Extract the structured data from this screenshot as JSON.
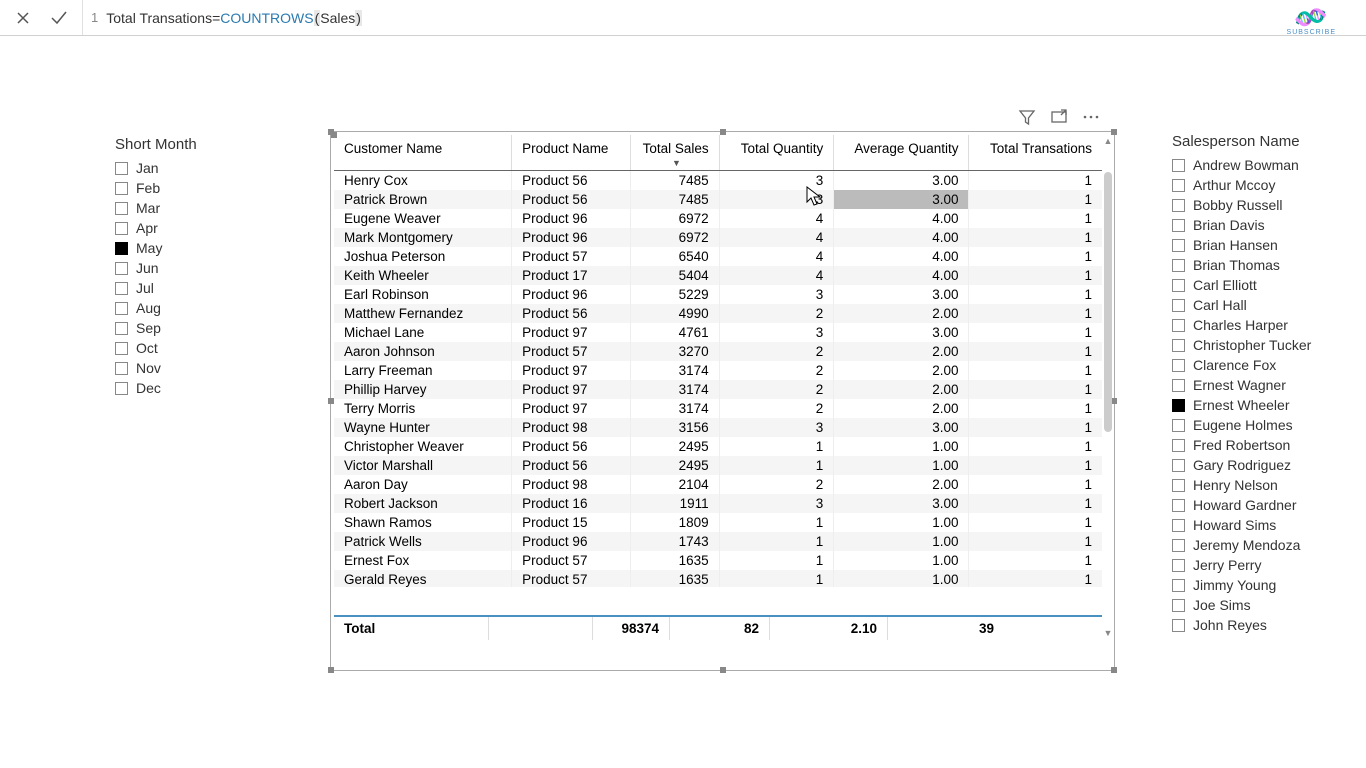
{
  "formula": {
    "line": "1",
    "measure": "Total Transations",
    "eq": " = ",
    "func": "COUNTROWS",
    "open": "(",
    "arg": " Sales ",
    "close": ")"
  },
  "monthSlicer": {
    "title": "Short Month",
    "items": [
      {
        "label": "Jan",
        "checked": false
      },
      {
        "label": "Feb",
        "checked": false
      },
      {
        "label": "Mar",
        "checked": false
      },
      {
        "label": "Apr",
        "checked": false
      },
      {
        "label": "May",
        "checked": true
      },
      {
        "label": "Jun",
        "checked": false
      },
      {
        "label": "Jul",
        "checked": false
      },
      {
        "label": "Aug",
        "checked": false
      },
      {
        "label": "Sep",
        "checked": false
      },
      {
        "label": "Oct",
        "checked": false
      },
      {
        "label": "Nov",
        "checked": false
      },
      {
        "label": "Dec",
        "checked": false
      }
    ]
  },
  "salesSlicer": {
    "title": "Salesperson Name",
    "items": [
      {
        "label": "Andrew Bowman",
        "checked": false
      },
      {
        "label": "Arthur Mccoy",
        "checked": false
      },
      {
        "label": "Bobby Russell",
        "checked": false
      },
      {
        "label": "Brian Davis",
        "checked": false
      },
      {
        "label": "Brian Hansen",
        "checked": false
      },
      {
        "label": "Brian Thomas",
        "checked": false
      },
      {
        "label": "Carl Elliott",
        "checked": false
      },
      {
        "label": "Carl Hall",
        "checked": false
      },
      {
        "label": "Charles Harper",
        "checked": false
      },
      {
        "label": "Christopher Tucker",
        "checked": false
      },
      {
        "label": "Clarence Fox",
        "checked": false
      },
      {
        "label": "Ernest Wagner",
        "checked": false
      },
      {
        "label": "Ernest Wheeler",
        "checked": true
      },
      {
        "label": "Eugene Holmes",
        "checked": false
      },
      {
        "label": "Fred Robertson",
        "checked": false
      },
      {
        "label": "Gary Rodriguez",
        "checked": false
      },
      {
        "label": "Henry Nelson",
        "checked": false
      },
      {
        "label": "Howard Gardner",
        "checked": false
      },
      {
        "label": "Howard Sims",
        "checked": false
      },
      {
        "label": "Jeremy Mendoza",
        "checked": false
      },
      {
        "label": "Jerry Perry",
        "checked": false
      },
      {
        "label": "Jimmy Young",
        "checked": false
      },
      {
        "label": "Joe Sims",
        "checked": false
      },
      {
        "label": "John Reyes",
        "checked": false
      }
    ]
  },
  "table": {
    "headers": [
      "Customer Name",
      "Product Name",
      "Total Sales",
      "Total Quantity",
      "Average Quantity",
      "Total Transations"
    ],
    "rows": [
      [
        "Henry Cox",
        "Product 56",
        "7485",
        "3",
        "3.00",
        "1"
      ],
      [
        "Patrick Brown",
        "Product 56",
        "7485",
        "3",
        "3.00",
        "1"
      ],
      [
        "Eugene Weaver",
        "Product 96",
        "6972",
        "4",
        "4.00",
        "1"
      ],
      [
        "Mark Montgomery",
        "Product 96",
        "6972",
        "4",
        "4.00",
        "1"
      ],
      [
        "Joshua Peterson",
        "Product 57",
        "6540",
        "4",
        "4.00",
        "1"
      ],
      [
        "Keith Wheeler",
        "Product 17",
        "5404",
        "4",
        "4.00",
        "1"
      ],
      [
        "Earl Robinson",
        "Product 96",
        "5229",
        "3",
        "3.00",
        "1"
      ],
      [
        "Matthew Fernandez",
        "Product 56",
        "4990",
        "2",
        "2.00",
        "1"
      ],
      [
        "Michael Lane",
        "Product 97",
        "4761",
        "3",
        "3.00",
        "1"
      ],
      [
        "Aaron Johnson",
        "Product 57",
        "3270",
        "2",
        "2.00",
        "1"
      ],
      [
        "Larry Freeman",
        "Product 97",
        "3174",
        "2",
        "2.00",
        "1"
      ],
      [
        "Phillip Harvey",
        "Product 97",
        "3174",
        "2",
        "2.00",
        "1"
      ],
      [
        "Terry Morris",
        "Product 97",
        "3174",
        "2",
        "2.00",
        "1"
      ],
      [
        "Wayne Hunter",
        "Product 98",
        "3156",
        "3",
        "3.00",
        "1"
      ],
      [
        "Christopher Weaver",
        "Product 56",
        "2495",
        "1",
        "1.00",
        "1"
      ],
      [
        "Victor Marshall",
        "Product 56",
        "2495",
        "1",
        "1.00",
        "1"
      ],
      [
        "Aaron Day",
        "Product 98",
        "2104",
        "2",
        "2.00",
        "1"
      ],
      [
        "Robert Jackson",
        "Product 16",
        "1911",
        "3",
        "3.00",
        "1"
      ],
      [
        "Shawn Ramos",
        "Product 15",
        "1809",
        "1",
        "1.00",
        "1"
      ],
      [
        "Patrick Wells",
        "Product 96",
        "1743",
        "1",
        "1.00",
        "1"
      ],
      [
        "Ernest Fox",
        "Product 57",
        "1635",
        "1",
        "1.00",
        "1"
      ],
      [
        "Gerald Reyes",
        "Product 57",
        "1635",
        "1",
        "1.00",
        "1"
      ]
    ],
    "totals": {
      "label": "Total",
      "sales": "98374",
      "qty": "82",
      "avg": "2.10",
      "trans": "39"
    }
  },
  "subscribe": "SUBSCRIBE"
}
